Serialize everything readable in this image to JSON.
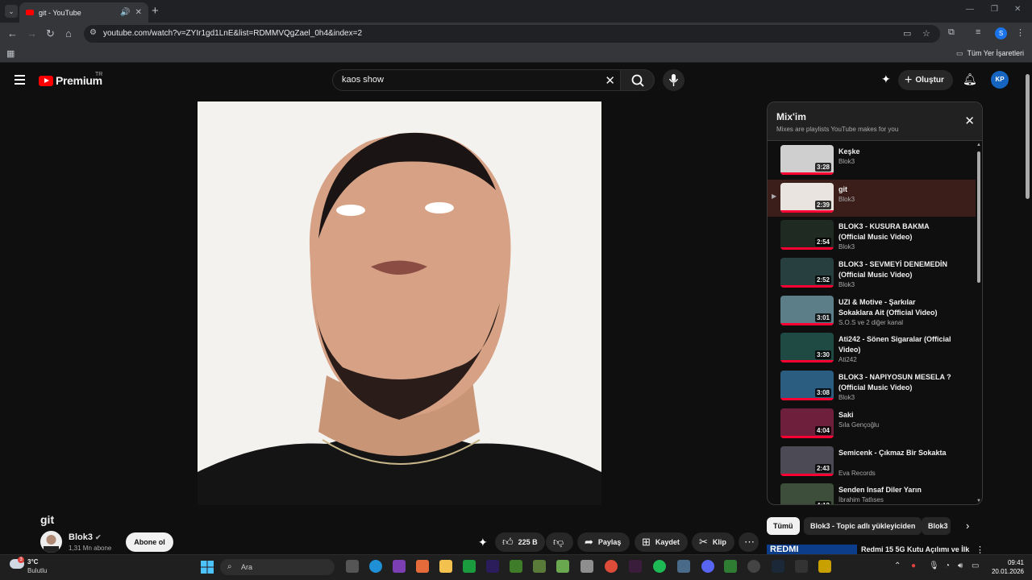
{
  "browser": {
    "tab_title": "git - YouTube",
    "url": "youtube.com/watch?v=ZYIr1gd1LnE&list=RDMMVQgZael_0h4&index=2",
    "bookmarks_all": "Tüm Yer İşaretleri",
    "profile_initial": "S"
  },
  "masthead": {
    "logo_text": "Premium",
    "region": "TR",
    "search_value": "kaos show",
    "create_label": "Oluştur",
    "avatar_initials": "KP"
  },
  "video": {
    "title": "git",
    "channel": "Blok3",
    "subscribers": "1,31 Mn abone",
    "subscribe_label": "Abone ol",
    "likes": "225 B",
    "share_label": "Paylaş",
    "save_label": "Kaydet",
    "clip_label": "Klip"
  },
  "playlist": {
    "title": "Mix'im",
    "subtitle": "Mixes are playlists YouTube makes for you",
    "items": [
      {
        "title": "Keşke",
        "channel": "Blok3",
        "duration": "3:28",
        "active": false,
        "color": "#cfcfcf"
      },
      {
        "title": "git",
        "channel": "Blok3",
        "duration": "2:39",
        "active": true,
        "color": "#e9e4df"
      },
      {
        "title": "BLOK3 - KUSURA BAKMA (Official Music Video)",
        "channel": "Blok3",
        "duration": "2:54",
        "active": false,
        "color": "#1e2a22"
      },
      {
        "title": "BLOK3 - SEVMEYİ DENEMEDİN (Official Music Video)",
        "channel": "Blok3",
        "duration": "2:52",
        "active": false,
        "color": "#27403f"
      },
      {
        "title": "UZI & Motive - Şarkılar Sokaklara Ait (Official Video)",
        "channel": "S.O.S ve 2 diğer kanal",
        "duration": "3:01",
        "active": false,
        "color": "#5c7e88"
      },
      {
        "title": "Ati242 - Sönen Sigaralar (Official Video)",
        "channel": "Ati242",
        "duration": "3:30",
        "active": false,
        "color": "#1f4a44"
      },
      {
        "title": "BLOK3 - NAPIYOSUN MESELA ? (Official Music Video)",
        "channel": "Blok3",
        "duration": "3:08",
        "active": false,
        "color": "#2a5d80"
      },
      {
        "title": "Saki",
        "channel": "Sıla Gençoğlu",
        "duration": "4:04",
        "active": false,
        "color": "#6e1f3c"
      },
      {
        "title": "Semicenk - Çıkmaz Bir Sokakta",
        "channel": "Eva Records",
        "duration": "2:43",
        "active": false,
        "color": "#4c4a55"
      },
      {
        "title": "Senden Insaf Diler Yarın",
        "channel": "İbrahim Tatlıses",
        "duration": "4:12",
        "active": false,
        "color": "#3d4f3a"
      }
    ]
  },
  "chips": [
    "Tümü",
    "Blok3 - Topic adlı yükleyiciden",
    "Blok3"
  ],
  "recommendation": {
    "thumb_text": "REDMI",
    "title": "Redmi 15 5G Kutu Açılımı ve İlk"
  },
  "taskbar": {
    "temperature": "3°C",
    "condition": "Bulutlu",
    "weather_badge": "3",
    "search_placeholder": "Ara",
    "time": "09:41",
    "date": "20.01.2026"
  }
}
